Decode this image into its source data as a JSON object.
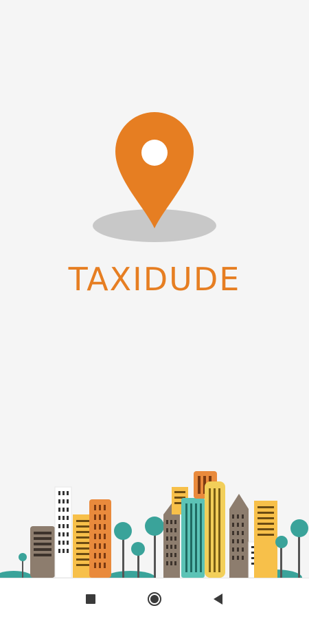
{
  "app": {
    "brand_name": "TAXIDUDE"
  },
  "colors": {
    "brand_orange": "#e67e22",
    "pin_shadow": "#c8c8c8",
    "background": "#f5f5f5",
    "building_brown": "#8d7d6e",
    "building_orange": "#e98a3c",
    "building_yellow": "#f7c04a",
    "building_teal": "#5cc3b6",
    "tree_teal": "#3aa39a",
    "nav_icon": "#3a3a3a"
  },
  "logo": {
    "icon": "map-pin-icon"
  },
  "navigation": {
    "recents_icon": "square-icon",
    "home_icon": "circle-icon",
    "back_icon": "triangle-back-icon"
  }
}
